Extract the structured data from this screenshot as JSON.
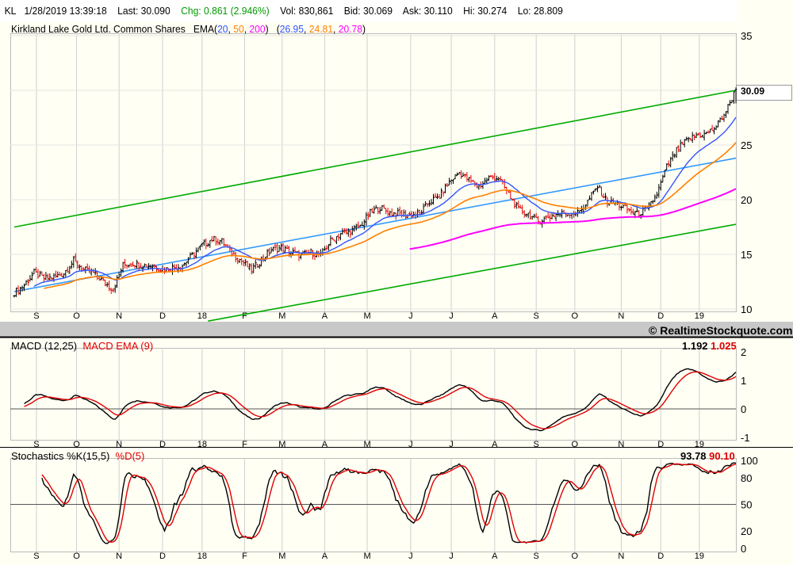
{
  "header": {
    "symbol": "KL",
    "datetime": "1/28/2019 13:39:18",
    "last": "Last: 30.090",
    "chg": "Chg: 0.861 (2.946%)",
    "vol": "Vol: 830,861",
    "bid": "Bid: 30.069",
    "ask": "Ask: 30.110",
    "hi": "Hi: 30.274",
    "lo": "Lo: 28.809"
  },
  "price_panel": {
    "title": "Kirkland Lake Gold Ltd. Common Shares",
    "ema_label": "EMA(",
    "ema_p1": "20",
    "ema_p2": "50",
    "ema_p3": "200",
    "ema_v1": "26.95",
    "ema_v2": "24.81",
    "ema_v3": "20.78",
    "last_box": "30.09"
  },
  "copyright": "© RealtimeStockquote.com",
  "macd_panel": {
    "label": "MACD (12,25)",
    "signal_label": "MACD EMA (9)",
    "macd_value": "1.192",
    "signal_value": "1.025"
  },
  "stoch_panel": {
    "label": "Stochastics %K(15,5)",
    "d_label": "%D(5)",
    "k_value": "93.78",
    "d_value": "90.10"
  },
  "colors": {
    "ema20": "#3355ff",
    "ema50": "#ff8000",
    "ema200": "#ff00ff",
    "channel": "#00aa00",
    "regression": "#3399ff",
    "up": "#000000",
    "down": "#e00000"
  },
  "chart_data": {
    "type": "ohlc",
    "weekly_closes": [
      11.5,
      12.2,
      13.3,
      12.8,
      12.9,
      13.3,
      14.4,
      13.6,
      13.3,
      12.5,
      11.8,
      14.0,
      14.2,
      14.0,
      14.0,
      13.6,
      13.8,
      14.0,
      14.9,
      15.8,
      16.4,
      16.2,
      15.1,
      14.4,
      13.6,
      14.5,
      15.4,
      15.6,
      15.2,
      14.9,
      15.2,
      14.9,
      16.2,
      16.9,
      17.1,
      17.6,
      18.8,
      19.3,
      18.8,
      18.7,
      18.6,
      18.7,
      19.8,
      20.3,
      21.6,
      22.5,
      21.8,
      21.2,
      22.0,
      22.0,
      20.5,
      19.1,
      18.7,
      18.0,
      18.4,
      18.7,
      18.8,
      18.8,
      19.8,
      21.2,
      19.8,
      19.6,
      19.1,
      18.7,
      19.1,
      20.5,
      23.0,
      24.5,
      25.4,
      25.9,
      26.0,
      26.7,
      28.1,
      30.09
    ],
    "month_labels": [
      {
        "t": "S",
        "w": 2.24
      },
      {
        "t": "O",
        "w": 6.3
      },
      {
        "t": "N",
        "w": 10.6
      },
      {
        "t": "D",
        "w": 15.0
      },
      {
        "t": "18",
        "w": 19.0
      },
      {
        "t": "F",
        "w": 23.3
      },
      {
        "t": "M",
        "w": 27.1
      },
      {
        "t": "A",
        "w": 31.4
      },
      {
        "t": "M",
        "w": 35.7
      },
      {
        "t": "J",
        "w": 40.1
      },
      {
        "t": "J",
        "w": 44.2
      },
      {
        "t": "A",
        "w": 48.6
      },
      {
        "t": "S",
        "w": 52.8
      },
      {
        "t": "O",
        "w": 56.7
      },
      {
        "t": "N",
        "w": 61.4
      },
      {
        "t": "D",
        "w": 65.4
      },
      {
        "t": "19",
        "w": 69.3
      }
    ],
    "price_ticks": [
      "35",
      "30",
      "25",
      "20",
      "15",
      "10"
    ],
    "macd_ticks": [
      "2",
      "1",
      "0",
      "-1"
    ],
    "stoch_ticks": [
      "100",
      "80",
      "50",
      "20",
      "0"
    ],
    "ylim_price": [
      10,
      35
    ],
    "ylim_macd": [
      -1,
      2
    ],
    "ylim_stoch": [
      0,
      100
    ],
    "trendlines": [
      {
        "name": "upper-channel",
        "start": 17.5,
        "end": 30.0,
        "startW": 0
      },
      {
        "name": "lower-channel",
        "start": 8.9,
        "end": 17.75,
        "startW": 19.6
      },
      {
        "name": "regression",
        "start": 11.6,
        "end": 23.8,
        "startW": 0
      }
    ]
  }
}
